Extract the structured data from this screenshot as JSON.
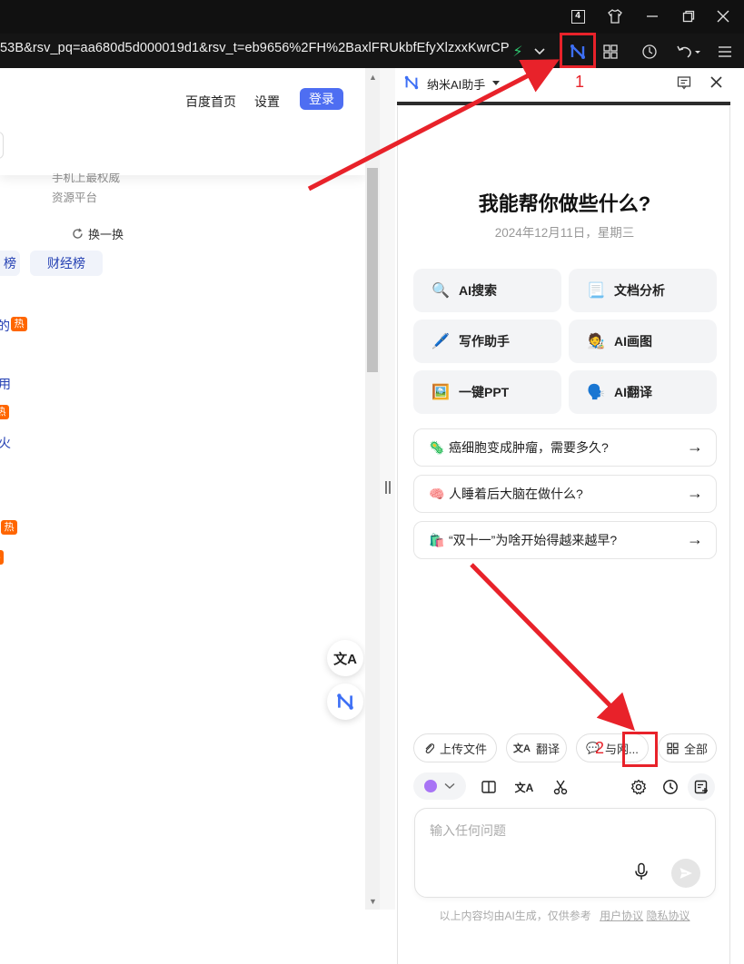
{
  "titlebar": {
    "tab_count": "4"
  },
  "address": {
    "url": "53B&rsv_pq=aa680d5d000019d1&rsv_t=eb9656%2FH%2BaxlFRUkbfEfyXlzxxKwrCPl"
  },
  "page": {
    "links": {
      "home": "百度首页",
      "settings": "设置",
      "login": "登录"
    },
    "sub_text_1": "手机上最权威",
    "sub_text_2": "资源平台",
    "refresh_label": "换一换",
    "chip_left": "榜",
    "chip_finance": "财经榜",
    "list_fragments": [
      "的",
      "用",
      "火"
    ],
    "hot_label": "热"
  },
  "panel": {
    "title": "纳米AI助手",
    "heading": "我能帮你做些什么?",
    "date": "2024年12月11日，星期三",
    "tiles": [
      {
        "emoji": "🔍",
        "label": "AI搜索"
      },
      {
        "emoji": "📃",
        "label": "文档分析"
      },
      {
        "emoji": "🖊️",
        "label": "写作助手"
      },
      {
        "emoji": "🧑‍🎨",
        "label": "AI画图"
      },
      {
        "emoji": "🖼️",
        "label": "一键PPT"
      },
      {
        "emoji": "🗣️",
        "label": "AI翻译"
      }
    ],
    "questions": [
      {
        "emoji": "🦠",
        "text": "癌细胞变成肿瘤，需要多久?"
      },
      {
        "emoji": "🧠",
        "text": "人睡着后大脑在做什么?"
      },
      {
        "emoji": "🛍️",
        "text": "“双十一”为啥开始得越来越早?"
      }
    ],
    "pills": {
      "upload": "上传文件",
      "translate": "翻译",
      "web": "与网...",
      "all": "全部"
    },
    "input_placeholder": "输入任何问题",
    "footer": {
      "disclaimer": "以上内容均由AI生成，仅供参考",
      "terms": "用户协议",
      "privacy": "隐私协议"
    }
  },
  "annotations": {
    "label_1": "1",
    "label_2": "2",
    "color": "#e8222a"
  },
  "colors": {
    "accent": "#4e6ef2",
    "hot": "#ff6600",
    "link": "#2440b3"
  }
}
